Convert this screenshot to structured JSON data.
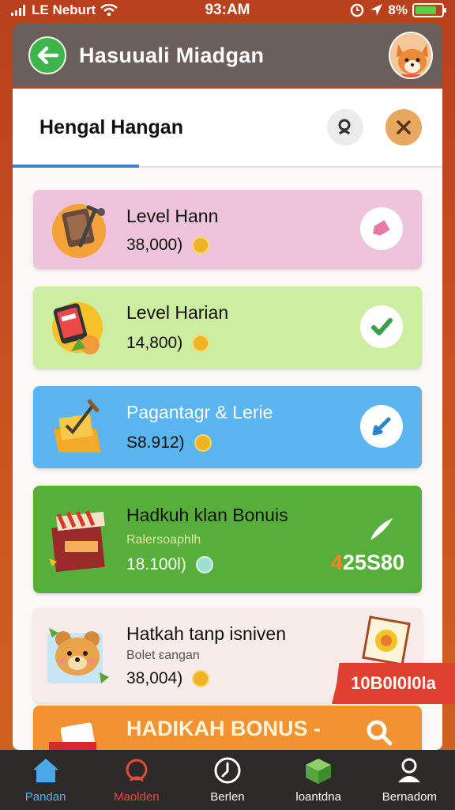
{
  "status_bar": {
    "carrier": "LE Neburt",
    "time": "93:AM",
    "battery": "8%",
    "battery_level_percent": 80,
    "battery_color": "#57d046"
  },
  "header": {
    "title": "Hasuuali Miadgan",
    "back_icon": "arrow-left-icon",
    "accent": "#3db54a"
  },
  "panel": {
    "title": "Hengal Hangan",
    "search_icon": "search-icon",
    "close_icon": "close-icon",
    "tab_color": "#3a86c8"
  },
  "cards": [
    {
      "title": "Level Hann",
      "value": "38,000)",
      "icon": "tv-icon",
      "action_icon": "tag-icon",
      "color": "#eec3dc"
    },
    {
      "title": "Level Harian",
      "value": "14,800)",
      "icon": "phone-icon",
      "action_icon": "check-icon",
      "color": "#cdeea0"
    },
    {
      "title": "Pagantagr & Lerie",
      "value": "S8.912)",
      "icon": "chest-icon",
      "action_icon": "check-icon",
      "color": "#5bb5f1"
    },
    {
      "title": "Hadkuh klan Bonuis",
      "subtitle": "Ralersoaphlh",
      "value": "18.100l)",
      "amount": "25S80",
      "icon": "shop-icon",
      "action_icon": "arrow-icon",
      "color": "#58ae3a"
    },
    {
      "title": "Hatkah tanp isniven",
      "subtitle": "Bolet ɛangan",
      "value": "38,004)",
      "icon": "bear-icon",
      "badge": "10B0l0l0la",
      "color": "#f7ece9"
    },
    {
      "title": "HADIKAH BONUS -",
      "icon": "gift-icon",
      "action_icon": "search-icon",
      "color": "#f39230"
    }
  ],
  "bottom_nav": [
    {
      "label": "Pandan",
      "icon": "home-icon",
      "state": "active"
    },
    {
      "label": "Maolden",
      "icon": "target-icon",
      "state": "alert"
    },
    {
      "label": "Berlen",
      "icon": "compass-icon",
      "state": "normal"
    },
    {
      "label": "loantdna",
      "icon": "box-icon",
      "state": "normal"
    },
    {
      "label": "Bernadom",
      "icon": "user-icon",
      "state": "normal"
    }
  ]
}
